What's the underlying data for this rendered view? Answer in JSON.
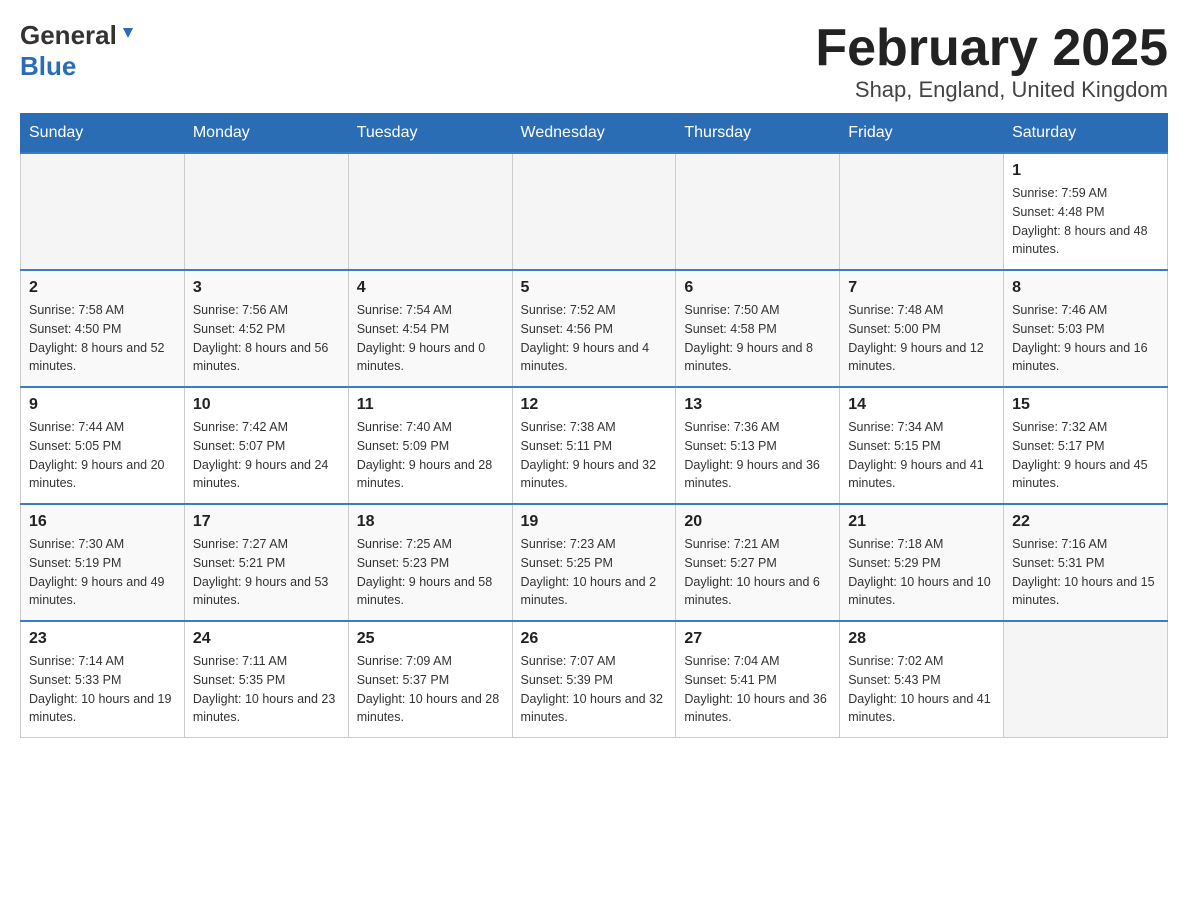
{
  "header": {
    "logo": {
      "general": "General",
      "blue": "Blue",
      "alt": "GeneralBlue logo"
    },
    "title": "February 2025",
    "location": "Shap, England, United Kingdom"
  },
  "weekdays": [
    "Sunday",
    "Monday",
    "Tuesday",
    "Wednesday",
    "Thursday",
    "Friday",
    "Saturday"
  ],
  "weeks": [
    [
      {
        "day": "",
        "info": ""
      },
      {
        "day": "",
        "info": ""
      },
      {
        "day": "",
        "info": ""
      },
      {
        "day": "",
        "info": ""
      },
      {
        "day": "",
        "info": ""
      },
      {
        "day": "",
        "info": ""
      },
      {
        "day": "1",
        "info": "Sunrise: 7:59 AM\nSunset: 4:48 PM\nDaylight: 8 hours and 48 minutes."
      }
    ],
    [
      {
        "day": "2",
        "info": "Sunrise: 7:58 AM\nSunset: 4:50 PM\nDaylight: 8 hours and 52 minutes."
      },
      {
        "day": "3",
        "info": "Sunrise: 7:56 AM\nSunset: 4:52 PM\nDaylight: 8 hours and 56 minutes."
      },
      {
        "day": "4",
        "info": "Sunrise: 7:54 AM\nSunset: 4:54 PM\nDaylight: 9 hours and 0 minutes."
      },
      {
        "day": "5",
        "info": "Sunrise: 7:52 AM\nSunset: 4:56 PM\nDaylight: 9 hours and 4 minutes."
      },
      {
        "day": "6",
        "info": "Sunrise: 7:50 AM\nSunset: 4:58 PM\nDaylight: 9 hours and 8 minutes."
      },
      {
        "day": "7",
        "info": "Sunrise: 7:48 AM\nSunset: 5:00 PM\nDaylight: 9 hours and 12 minutes."
      },
      {
        "day": "8",
        "info": "Sunrise: 7:46 AM\nSunset: 5:03 PM\nDaylight: 9 hours and 16 minutes."
      }
    ],
    [
      {
        "day": "9",
        "info": "Sunrise: 7:44 AM\nSunset: 5:05 PM\nDaylight: 9 hours and 20 minutes."
      },
      {
        "day": "10",
        "info": "Sunrise: 7:42 AM\nSunset: 5:07 PM\nDaylight: 9 hours and 24 minutes."
      },
      {
        "day": "11",
        "info": "Sunrise: 7:40 AM\nSunset: 5:09 PM\nDaylight: 9 hours and 28 minutes."
      },
      {
        "day": "12",
        "info": "Sunrise: 7:38 AM\nSunset: 5:11 PM\nDaylight: 9 hours and 32 minutes."
      },
      {
        "day": "13",
        "info": "Sunrise: 7:36 AM\nSunset: 5:13 PM\nDaylight: 9 hours and 36 minutes."
      },
      {
        "day": "14",
        "info": "Sunrise: 7:34 AM\nSunset: 5:15 PM\nDaylight: 9 hours and 41 minutes."
      },
      {
        "day": "15",
        "info": "Sunrise: 7:32 AM\nSunset: 5:17 PM\nDaylight: 9 hours and 45 minutes."
      }
    ],
    [
      {
        "day": "16",
        "info": "Sunrise: 7:30 AM\nSunset: 5:19 PM\nDaylight: 9 hours and 49 minutes."
      },
      {
        "day": "17",
        "info": "Sunrise: 7:27 AM\nSunset: 5:21 PM\nDaylight: 9 hours and 53 minutes."
      },
      {
        "day": "18",
        "info": "Sunrise: 7:25 AM\nSunset: 5:23 PM\nDaylight: 9 hours and 58 minutes."
      },
      {
        "day": "19",
        "info": "Sunrise: 7:23 AM\nSunset: 5:25 PM\nDaylight: 10 hours and 2 minutes."
      },
      {
        "day": "20",
        "info": "Sunrise: 7:21 AM\nSunset: 5:27 PM\nDaylight: 10 hours and 6 minutes."
      },
      {
        "day": "21",
        "info": "Sunrise: 7:18 AM\nSunset: 5:29 PM\nDaylight: 10 hours and 10 minutes."
      },
      {
        "day": "22",
        "info": "Sunrise: 7:16 AM\nSunset: 5:31 PM\nDaylight: 10 hours and 15 minutes."
      }
    ],
    [
      {
        "day": "23",
        "info": "Sunrise: 7:14 AM\nSunset: 5:33 PM\nDaylight: 10 hours and 19 minutes."
      },
      {
        "day": "24",
        "info": "Sunrise: 7:11 AM\nSunset: 5:35 PM\nDaylight: 10 hours and 23 minutes."
      },
      {
        "day": "25",
        "info": "Sunrise: 7:09 AM\nSunset: 5:37 PM\nDaylight: 10 hours and 28 minutes."
      },
      {
        "day": "26",
        "info": "Sunrise: 7:07 AM\nSunset: 5:39 PM\nDaylight: 10 hours and 32 minutes."
      },
      {
        "day": "27",
        "info": "Sunrise: 7:04 AM\nSunset: 5:41 PM\nDaylight: 10 hours and 36 minutes."
      },
      {
        "day": "28",
        "info": "Sunrise: 7:02 AM\nSunset: 5:43 PM\nDaylight: 10 hours and 41 minutes."
      },
      {
        "day": "",
        "info": ""
      }
    ]
  ]
}
